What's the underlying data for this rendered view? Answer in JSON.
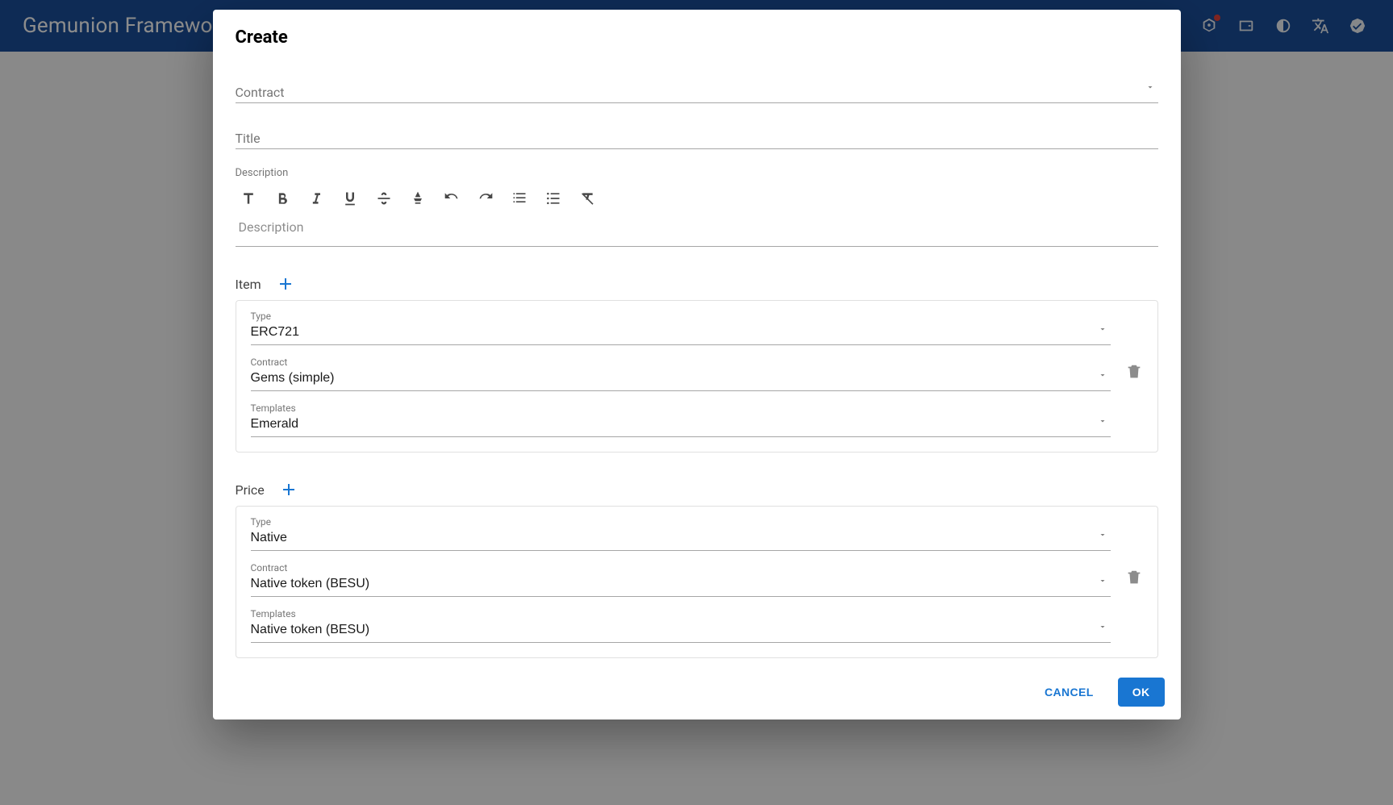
{
  "header": {
    "title": "Gemunion Framework - Admin panel"
  },
  "dialog": {
    "title": "Create",
    "contract": {
      "label": "Contract",
      "value": ""
    },
    "titleField": {
      "label": "Title",
      "value": ""
    },
    "description": {
      "label": "Description",
      "placeholder": "Description",
      "value": ""
    },
    "item": {
      "heading": "Item",
      "type": {
        "label": "Type",
        "value": "ERC721"
      },
      "contract": {
        "label": "Contract",
        "value": "Gems (simple)"
      },
      "templates": {
        "label": "Templates",
        "value": "Emerald"
      }
    },
    "price": {
      "heading": "Price",
      "type": {
        "label": "Type",
        "value": "Native"
      },
      "contract": {
        "label": "Contract",
        "value": "Native token (BESU)"
      },
      "templates": {
        "label": "Templates",
        "value": "Native token (BESU)"
      }
    },
    "actions": {
      "cancel": "Cancel",
      "ok": "OK"
    }
  }
}
